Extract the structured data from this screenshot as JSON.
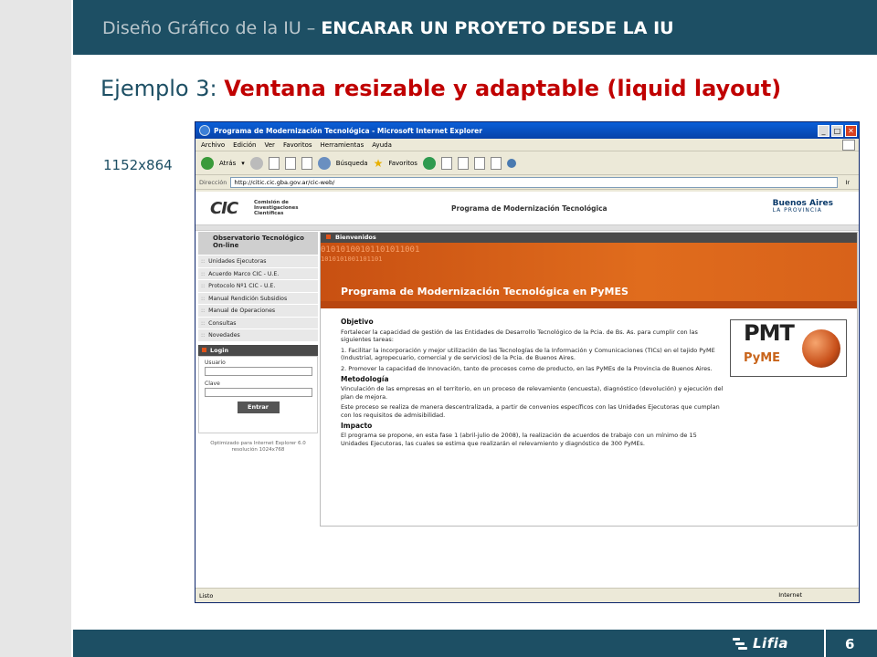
{
  "slide": {
    "header_prefix": "Diseño Gráfico de la IU – ",
    "header_bold": "ENCARAR UN PROYETO DESDE LA IU",
    "title_prefix": "Ejemplo 3: ",
    "title_highlight": "Ventana resizable y adaptable (liquid layout)",
    "resolution": "1152x864",
    "logo_text": "Lifia",
    "page_number": "6"
  },
  "browser": {
    "window_title": "Programa de Modernización Tecnológica - Microsoft Internet Explorer",
    "menu": [
      "Archivo",
      "Edición",
      "Ver",
      "Favoritos",
      "Herramientas",
      "Ayuda"
    ],
    "toolbar": {
      "back": "Atrás",
      "search": "Búsqueda",
      "favorites": "Favoritos"
    },
    "address_label": "Dirección",
    "url": "http://citic.cic.gba.gov.ar/cic-web/",
    "go_label": "Ir",
    "status_text": "Listo",
    "status_zone": "Internet"
  },
  "site": {
    "cic_logo": "CIC",
    "cic_sub": "Comisión de Investigaciones Científicas",
    "title": "Programa de Modernización Tecnológica",
    "ba_logo": "Buenos Aires",
    "ba_sub": "LA PROVINCIA",
    "sidebar_heading": "Observatorio Tecnológico On-line",
    "sidebar_items": [
      "Unidades Ejecutoras",
      "Acuerdo Marco CIC - U.E.",
      "Protocolo Nº1 CIC - U.E.",
      "Manual Rendición Subsidios",
      "Manual de Operaciones",
      "Consultas",
      "Novedades"
    ],
    "login": {
      "heading": "Login",
      "user_label": "Usuario",
      "password_label": "Clave",
      "submit": "Entrar"
    },
    "optimized": "Optimizado para Internet Explorer 6.0 resolución 1024x768",
    "content_heading": "Bienvenidos",
    "binary_1": "01010100101101011001",
    "binary_2": "1010101001101101",
    "banner_title": "Programa de Modernización Tecnológica en PyMES",
    "sections": [
      {
        "heading": "Objetivo",
        "paragraphs": [
          "Fortalecer la capacidad de gestión de las Entidades de Desarrollo Tecnológico de la Pcia. de Bs. As. para cumplir con las siguientes tareas:",
          "1. Facilitar la incorporación y mejor utilización de las Tecnologías de la Información y Comunicaciones (TICs) en el tejido PyME (Industrial, agropecuario, comercial y de servicios) de la Pcia. de Buenos Aires.",
          "2. Promover la capacidad de Innovación, tanto de procesos como de producto, en las PyMEs de la Provincia de Buenos Aires."
        ]
      },
      {
        "heading": "Metodología",
        "paragraphs": [
          "Vinculación de las empresas en el territorio, en un proceso de relevamiento (encuesta), diagnóstico (devolución) y ejecución del plan de mejora.",
          "Este proceso se realiza de manera descentralizada, a partir de convenios específicos con las Unidades Ejecutoras que cumplan con los requisitos de admisibilidad."
        ]
      },
      {
        "heading": "Impacto",
        "paragraphs": [
          "El programa se propone, en esta fase 1 (abril-julio de 2008), la realización de acuerdos de trabajo con un mínimo de 15 Unidades Ejecutoras, las cuales se estima que realizarán el relevamiento y diagnóstico de 300 PyMEs."
        ]
      }
    ],
    "pmt_logo": {
      "top": "PMT",
      "bottom": "PyME"
    }
  },
  "colors": {
    "slide_navy": "#1d4f64",
    "slide_red": "#c00000",
    "banner_orange": "#e06c1d"
  }
}
